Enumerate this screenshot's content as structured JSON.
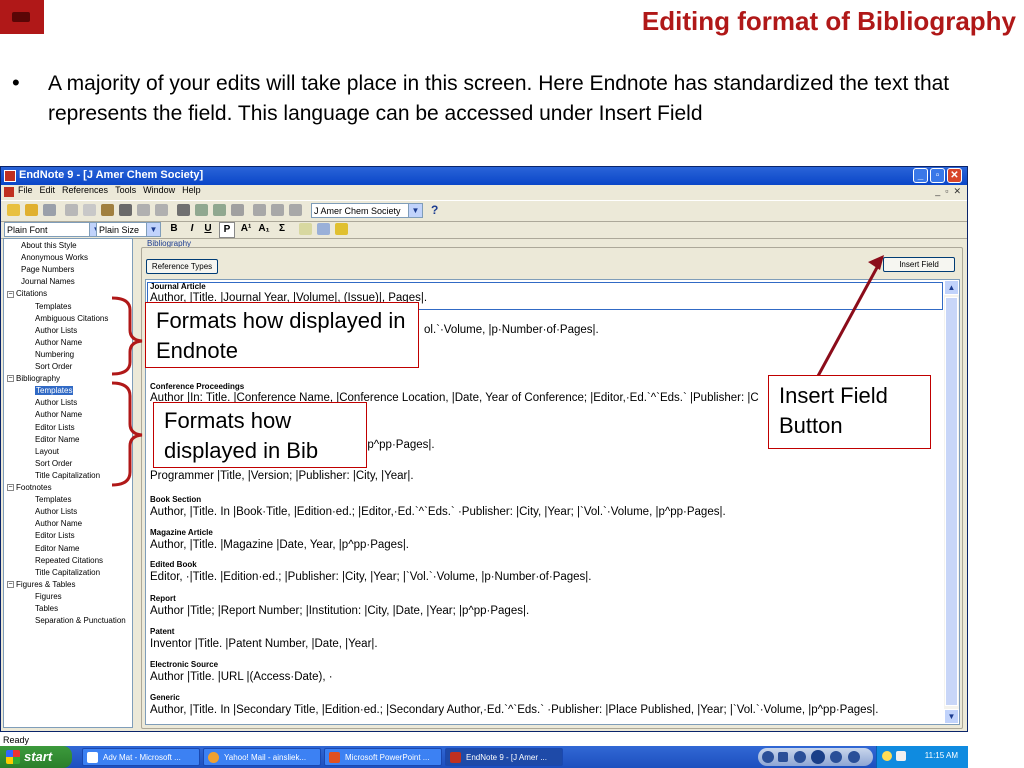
{
  "slide": {
    "title": "Editing format of Bibliography",
    "bullet": "A majority of your edits will take place in this screen.  Here Endnote has standardized the text that represents the field.  This language can be accessed under Insert Field"
  },
  "window": {
    "title": "EndNote 9 - [J Amer Chem Society]",
    "menu": [
      "File",
      "Edit",
      "References",
      "Tools",
      "Window",
      "Help"
    ],
    "style_select": "J Amer Chem Society",
    "font_select": "Plain Font",
    "size_select": "Plain Size",
    "format_buttons": [
      "B",
      "I",
      "U",
      "P",
      "A¹",
      "A₁",
      "Σ"
    ]
  },
  "tree": {
    "items": [
      {
        "label": "About this Style",
        "level": 1
      },
      {
        "label": "Anonymous Works",
        "level": 1
      },
      {
        "label": "Page Numbers",
        "level": 1
      },
      {
        "label": "Journal Names",
        "level": 1
      },
      {
        "label": "Citations",
        "level": 0,
        "expander": "⊟"
      },
      {
        "label": "Templates",
        "level": 2
      },
      {
        "label": "Ambiguous Citations",
        "level": 2
      },
      {
        "label": "Author Lists",
        "level": 2
      },
      {
        "label": "Author Name",
        "level": 2
      },
      {
        "label": "Numbering",
        "level": 2
      },
      {
        "label": "Sort Order",
        "level": 2
      },
      {
        "label": "Bibliography",
        "level": 0,
        "expander": "⊟"
      },
      {
        "label": "Templates",
        "level": 2,
        "selected": true
      },
      {
        "label": "Author Lists",
        "level": 2
      },
      {
        "label": "Author Name",
        "level": 2
      },
      {
        "label": "Editor Lists",
        "level": 2
      },
      {
        "label": "Editor Name",
        "level": 2
      },
      {
        "label": "Layout",
        "level": 2
      },
      {
        "label": "Sort Order",
        "level": 2
      },
      {
        "label": "Title Capitalization",
        "level": 2
      },
      {
        "label": "Footnotes",
        "level": 0,
        "expander": "⊟"
      },
      {
        "label": "Templates",
        "level": 2
      },
      {
        "label": "Author Lists",
        "level": 2
      },
      {
        "label": "Author Name",
        "level": 2
      },
      {
        "label": "Editor Lists",
        "level": 2
      },
      {
        "label": "Editor Name",
        "level": 2
      },
      {
        "label": "Repeated Citations",
        "level": 2
      },
      {
        "label": "Title Capitalization",
        "level": 2
      },
      {
        "label": "Figures & Tables",
        "level": 0,
        "expander": "⊟"
      },
      {
        "label": "Figures",
        "level": 2
      },
      {
        "label": "Tables",
        "level": 2
      },
      {
        "label": "Separation & Punctuation",
        "level": 2
      }
    ]
  },
  "bibliography": {
    "label": "Bibliography",
    "reference_types_button": "Reference Types",
    "insert_field_button": "Insert Field",
    "entries": [
      {
        "type": "Journal Article",
        "format": "Author, |Title. |Journal Year, |Volume|, (Issue)|, Pages|."
      },
      {
        "type": "",
        "format": "ol.`·Volume, |p·Number·of·Pages|."
      },
      {
        "type": "Conference Proceedings",
        "format": "Author |In: Title. |Conference Name, |Conference Location, |Date, Year of Conference; |Editor,·Ed.`^`Eds.` |Publisher: |C"
      },
      {
        "type": "",
        "format": "ear, |p^pp·Pages|."
      },
      {
        "type": "",
        "format": "Programmer |Title, |Version; |Publisher: |City, |Year|."
      },
      {
        "type": "Book Section",
        "format": "Author, |Title. In |Book·Title, |Edition·ed.; |Editor,·Ed.`^`Eds.` ·Publisher: |City, |Year; |`Vol.`·Volume, |p^pp·Pages|."
      },
      {
        "type": "Magazine Article",
        "format": "Author, |Title. |Magazine |Date, Year, |p^pp·Pages|."
      },
      {
        "type": "Edited Book",
        "format": "Editor, ·|Title. |Edition·ed.; |Publisher: |City, |Year; |`Vol.`·Volume, |p·Number·of·Pages|."
      },
      {
        "type": "Report",
        "format": "Author |Title; |Report Number; |Institution: |City, |Date, |Year; |p^pp·Pages|."
      },
      {
        "type": "Patent",
        "format": "Inventor |Title. |Patent Number, |Date, |Year|."
      },
      {
        "type": "Electronic Source",
        "format": "Author |Title. |URL |(Access·Date), ·"
      },
      {
        "type": "Generic",
        "format": "Author, |Title. In |Secondary Title, |Edition·ed.; |Secondary Author,·Ed.`^`Eds.` ·Publisher: |Place Published, |Year; |`Vol.`·Volume, |p^pp·Pages|."
      }
    ]
  },
  "status": "Ready",
  "taskbar": {
    "start": "start",
    "tasks": [
      "Adv Mat - Microsoft ...",
      "Yahoo! Mail - ainsliek...",
      "Microsoft PowerPoint ...",
      "EndNote 9 - [J Amer ..."
    ],
    "clock": "11:15 AM"
  },
  "callouts": {
    "endnote": "Formats how displayed in Endnote",
    "bib": "Formats how displayed in Bib",
    "insert_field": "Insert Field Button"
  },
  "colors": {
    "accent": "#b01818",
    "annotation": "#c00000",
    "selection": "#316ac5"
  }
}
